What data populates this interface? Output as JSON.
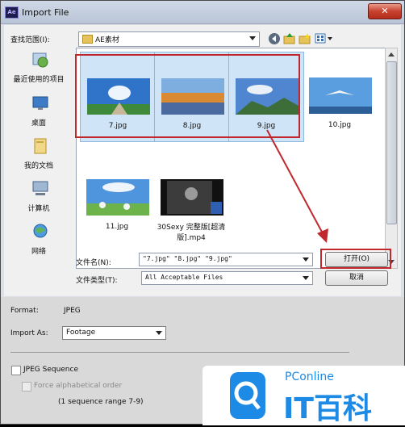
{
  "window": {
    "title": "Import File",
    "app_icon": "Ae",
    "close_glyph": "✕"
  },
  "toolbar": {
    "look_in_label": "查找范围(I):",
    "look_in_value": "AE素材",
    "icons": [
      "back-icon",
      "up-folder-icon",
      "new-folder-icon",
      "view-menu-icon"
    ]
  },
  "places": [
    {
      "label": "最近使用的项目",
      "icon": "recent-items-icon"
    },
    {
      "label": "桌面",
      "icon": "desktop-icon"
    },
    {
      "label": "我的文档",
      "icon": "documents-icon"
    },
    {
      "label": "计算机",
      "icon": "computer-icon"
    },
    {
      "label": "网络",
      "icon": "network-icon"
    }
  ],
  "files": [
    {
      "name": "7.jpg",
      "selected": true
    },
    {
      "name": "8.jpg",
      "selected": true
    },
    {
      "name": "9.jpg",
      "selected": true
    },
    {
      "name": "10.jpg",
      "selected": false
    },
    {
      "name": "11.jpg",
      "selected": false
    },
    {
      "name": "30Sexy 完整版[超清版].mp4",
      "selected": false
    }
  ],
  "file_name": {
    "label": "文件名(N):",
    "value": "\"7.jpg\" \"8.jpg\" \"9.jpg\""
  },
  "file_type": {
    "label": "文件类型(T):",
    "value": "All Acceptable Files"
  },
  "buttons": {
    "open": "打开(O)",
    "cancel": "取消"
  },
  "options": {
    "format_label": "Format:",
    "format_value": "JPEG",
    "import_as_label": "Import As:",
    "import_as_value": "Footage",
    "sequence_label": "JPEG Sequence",
    "alpha_label": "Force alphabetical order",
    "sequence_range": "(1 sequence range 7-9)"
  },
  "watermark": {
    "brand_top": "PConline",
    "brand_main": "IT百科"
  },
  "colors": {
    "selection": "#cfe4f7",
    "annotation_red": "#c0282d",
    "title_bar": "#c4cedc",
    "logo_blue": "#1d8be6"
  }
}
